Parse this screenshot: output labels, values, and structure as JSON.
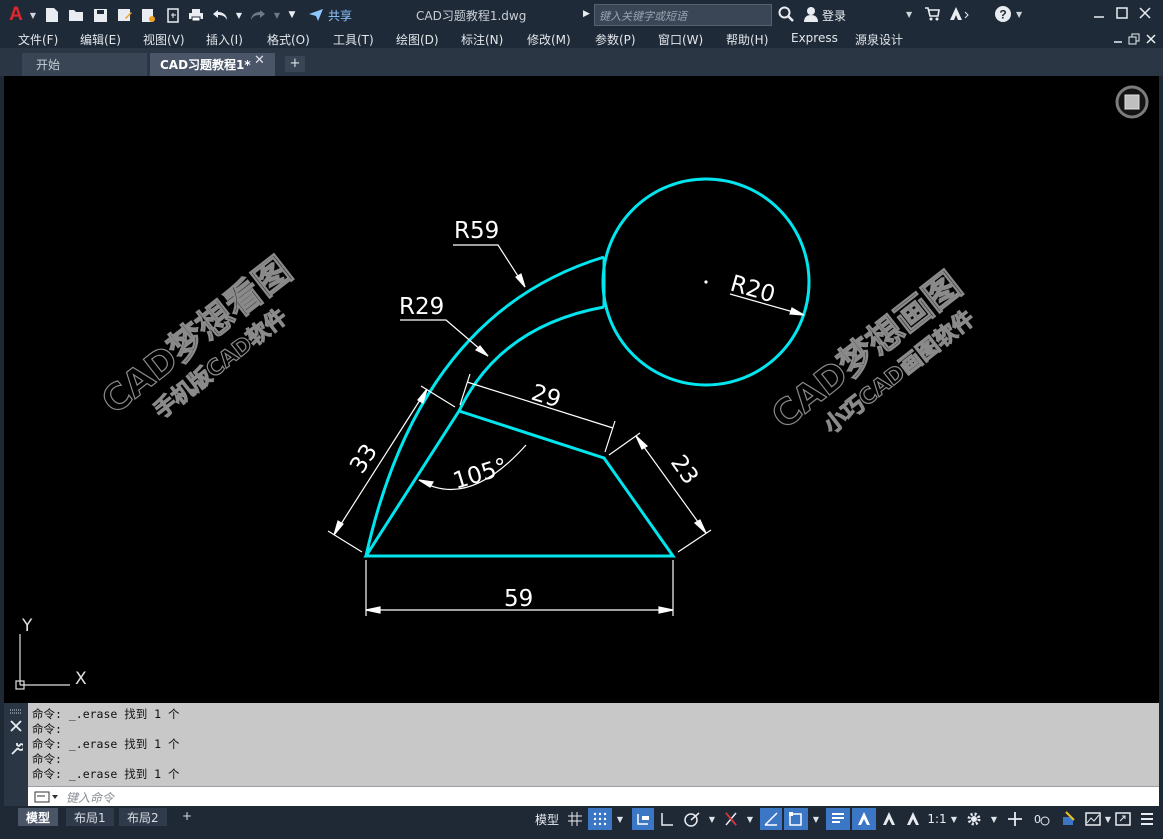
{
  "title_bar": {
    "app_logo": "A",
    "share_label": "共享",
    "document_title": "CAD习题教程1.dwg",
    "search_placeholder": "键入关键字或短语",
    "login_label": "登录",
    "help_label": "?"
  },
  "menu": [
    "文件(F)",
    "编辑(E)",
    "视图(V)",
    "插入(I)",
    "格式(O)",
    "工具(T)",
    "绘图(D)",
    "标注(N)",
    "修改(M)",
    "参数(P)",
    "窗口(W)",
    "帮助(H)",
    "Express",
    "源泉设计"
  ],
  "tabs": {
    "start": "开始",
    "document": "CAD习题教程1*",
    "close": "✕",
    "add": "+"
  },
  "drawing": {
    "dimensions": {
      "r59": "R59",
      "r29": "R29",
      "r20": "R20",
      "d29": "29",
      "d33": "33",
      "d23": "23",
      "d59": "59",
      "angle": "105°"
    },
    "ucs": {
      "x": "X",
      "y": "Y"
    },
    "watermark_left": {
      "main": "CAD梦想看图",
      "sub": "手机版CAD软件"
    },
    "watermark_right": {
      "main": "CAD梦想画图",
      "sub": "小巧CAD画图软件"
    }
  },
  "command": {
    "history": [
      "命令: _.erase 找到 1 个",
      "命令:",
      "命令: _.erase 找到 1 个",
      "命令:",
      "命令: _.erase 找到 1 个"
    ],
    "input_placeholder": "键入命令"
  },
  "layout_tabs": [
    "模型",
    "布局1",
    "布局2",
    "+"
  ],
  "status": {
    "model_label": "模型",
    "annotation_scale": "1:1"
  },
  "colors": {
    "geometry": "#00e5ee",
    "dimension": "#ffffff",
    "canvas": "#000000",
    "watermark": "#8a8a8a"
  }
}
